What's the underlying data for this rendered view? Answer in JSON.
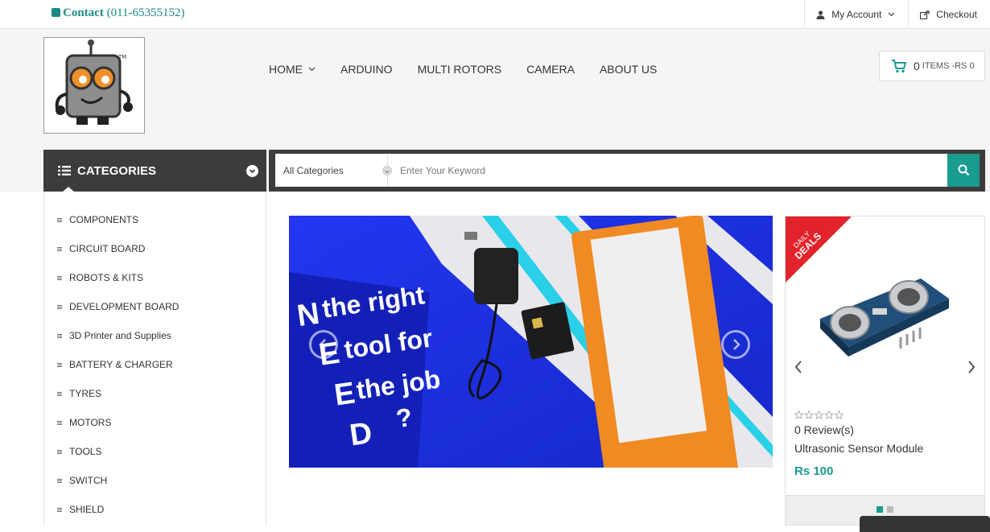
{
  "topbar": {
    "contact_label": "Contact",
    "contact_phone": "(011-65355152)",
    "my_account": "My Account",
    "checkout": "Checkout"
  },
  "nav": {
    "items": [
      "HOME",
      "ARDUINO",
      "MULTI ROTORS",
      "CAMERA",
      "ABOUT US"
    ]
  },
  "cart": {
    "count": "0",
    "label": "ITEMS -RS 0"
  },
  "categories": {
    "title": "CATEGORIES",
    "items": [
      "COMPONENTS",
      "CIRCUIT BOARD",
      "ROBOTS & KITS",
      "DEVELOPMENT BOARD",
      "3D Printer and Supplies",
      "BATTERY & CHARGER",
      "TYRES",
      "MOTORS",
      "TOOLS",
      "SWITCH",
      "SHIELD"
    ]
  },
  "search": {
    "category_selected": "All Categories",
    "placeholder": "Enter Your Keyword"
  },
  "banner": {
    "text_lines": [
      "N the right",
      "E tool for",
      "E the job",
      "D ?"
    ]
  },
  "deals": {
    "badge_line1": "DAILY",
    "badge_line2": "DEALS",
    "reviews": "0 Review(s)",
    "product_name": "Ultrasonic Sensor Module",
    "price": "Rs 100",
    "rating": 0
  },
  "colors": {
    "accent": "#1a9b8f",
    "dark_bar": "#3d3c3a",
    "deal_red": "#e2232b",
    "banner_blue": "#1d33e8"
  }
}
